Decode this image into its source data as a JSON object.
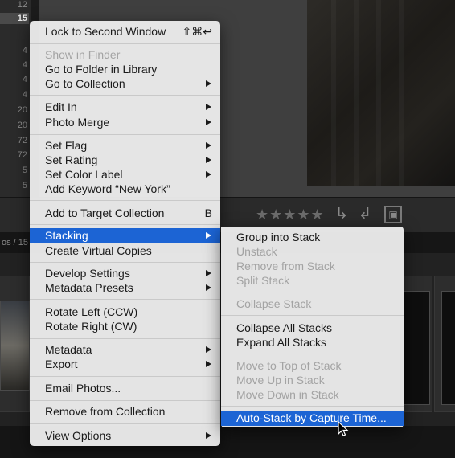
{
  "left_panel": {
    "counts": [
      "12",
      "15",
      "4",
      "4",
      "4",
      "4",
      "20",
      "20",
      "72",
      "72",
      "5",
      "5"
    ]
  },
  "filmstrip": {
    "info_text": "os / 15 ▾"
  },
  "toolbar": {
    "stars": "★★★★★"
  },
  "menu": {
    "items": [
      {
        "label": "Lock to Second Window",
        "shortcut": "⇧⌘↩",
        "enabled": true,
        "submenu": false
      },
      {
        "label": "Show in Finder",
        "enabled": false,
        "submenu": false
      },
      {
        "label": "Go to Folder in Library",
        "enabled": true,
        "submenu": false
      },
      {
        "label": "Go to Collection",
        "enabled": true,
        "submenu": true
      },
      {
        "label": "Edit In",
        "enabled": true,
        "submenu": true
      },
      {
        "label": "Photo Merge",
        "enabled": true,
        "submenu": true
      },
      {
        "label": "Set Flag",
        "enabled": true,
        "submenu": true
      },
      {
        "label": "Set Rating",
        "enabled": true,
        "submenu": true
      },
      {
        "label": "Set Color Label",
        "enabled": true,
        "submenu": true
      },
      {
        "label": "Add Keyword “New York”",
        "enabled": true,
        "submenu": false
      },
      {
        "label": "Add to Target Collection",
        "shortcut": "B",
        "enabled": true,
        "submenu": false
      },
      {
        "label": "Stacking",
        "enabled": true,
        "submenu": true,
        "selected": true
      },
      {
        "label": "Create Virtual Copies",
        "enabled": true,
        "submenu": false
      },
      {
        "label": "Develop Settings",
        "enabled": true,
        "submenu": true
      },
      {
        "label": "Metadata Presets",
        "enabled": true,
        "submenu": true
      },
      {
        "label": "Rotate Left (CCW)",
        "enabled": true,
        "submenu": false
      },
      {
        "label": "Rotate Right (CW)",
        "enabled": true,
        "submenu": false
      },
      {
        "label": "Metadata",
        "enabled": true,
        "submenu": true
      },
      {
        "label": "Export",
        "enabled": true,
        "submenu": true
      },
      {
        "label": "Email Photos...",
        "enabled": true,
        "submenu": false
      },
      {
        "label": "Remove from Collection",
        "enabled": true,
        "submenu": false
      },
      {
        "label": "View Options",
        "enabled": true,
        "submenu": true
      }
    ]
  },
  "submenu": {
    "items": [
      {
        "label": "Group into Stack",
        "enabled": true
      },
      {
        "label": "Unstack",
        "enabled": false
      },
      {
        "label": "Remove from Stack",
        "enabled": false
      },
      {
        "label": "Split Stack",
        "enabled": false
      },
      {
        "label": "Collapse Stack",
        "enabled": false
      },
      {
        "label": "Collapse All Stacks",
        "enabled": true
      },
      {
        "label": "Expand All Stacks",
        "enabled": true
      },
      {
        "label": "Move to Top of Stack",
        "enabled": false
      },
      {
        "label": "Move Up in Stack",
        "enabled": false
      },
      {
        "label": "Move Down in Stack",
        "enabled": false
      },
      {
        "label": "Auto-Stack by Capture Time...",
        "enabled": true,
        "selected": true
      }
    ]
  },
  "colors": {
    "selection": "#1c64d4",
    "menu_bg": "#eaeaea",
    "disabled_text": "#a3a3a3"
  }
}
